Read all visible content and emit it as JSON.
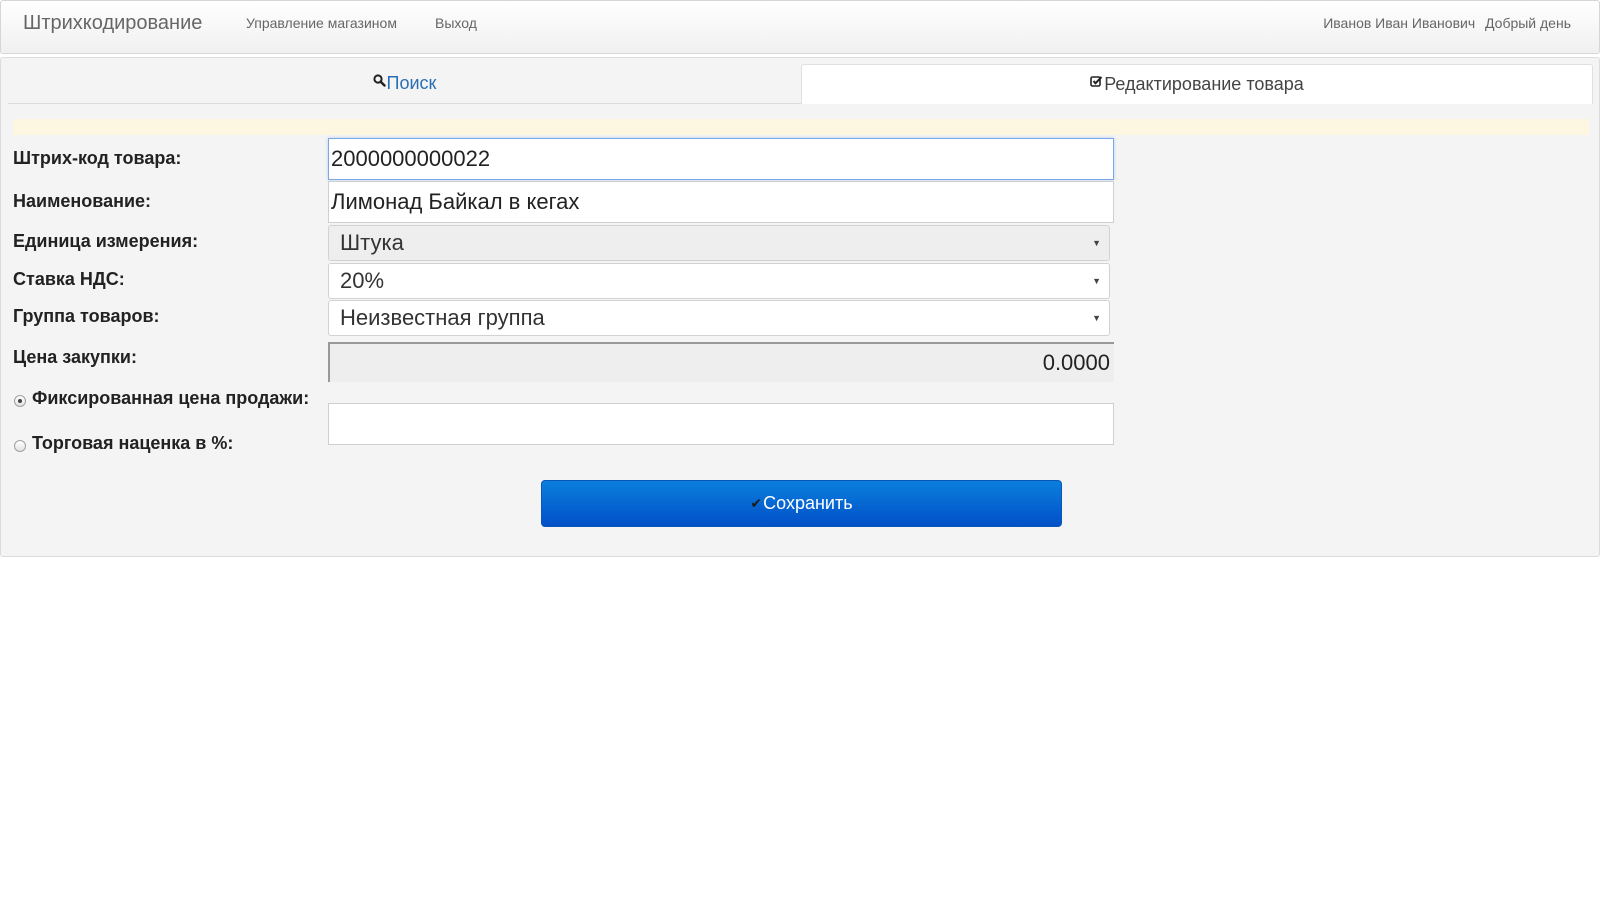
{
  "navbar": {
    "brand": "Штрихкодирование",
    "links": [
      "Управление магазином",
      "Выход"
    ],
    "user_name": "Иванов Иван Иванович",
    "greeting": "Добрый день"
  },
  "tabs": [
    {
      "label": "Поиск",
      "icon": "search-icon",
      "active": false
    },
    {
      "label": "Редактирование товара",
      "icon": "edit-check-icon",
      "active": true
    }
  ],
  "form": {
    "barcode": {
      "label": "Штрих-код товара:",
      "value": "2000000000022"
    },
    "name": {
      "label": "Наименование:",
      "value": "Лимонад Байкал в кегах"
    },
    "unit": {
      "label": "Единица измерения:",
      "selected": "Штука"
    },
    "vat": {
      "label": "Ставка НДС:",
      "selected": "20%"
    },
    "group": {
      "label": "Группа товаров:",
      "selected": "Неизвестная группа"
    },
    "purchase_price": {
      "label": "Цена закупки:",
      "value": "0.0000"
    },
    "pricing_mode": {
      "fixed_label": "Фиксированная цена продажи:",
      "markup_label": "Торговая наценка в %:",
      "selected": "fixed"
    },
    "price_value": ""
  },
  "actions": {
    "save_label": "Сохранить"
  },
  "colors": {
    "tab_link": "#2a6fb5",
    "button_top": "#0a7fdc",
    "button_bottom": "#0250c8",
    "notice_bg": "#fdf7e2"
  }
}
